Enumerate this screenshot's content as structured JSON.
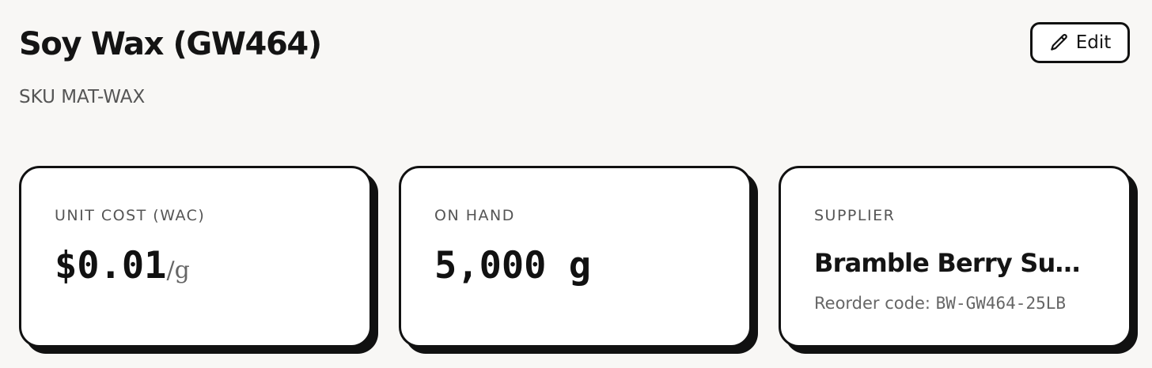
{
  "header": {
    "title": "Soy Wax (GW464)",
    "sku": "SKU MAT-WAX",
    "edit_label": "Edit",
    "edit_icon": "pencil-icon"
  },
  "cards": {
    "unit_cost": {
      "label": "UNIT COST (WAC)",
      "value": "$0.01",
      "unit": "/g"
    },
    "on_hand": {
      "label": "ON HAND",
      "value": "5,000 g"
    },
    "supplier": {
      "label": "SUPPLIER",
      "name": "Bramble Berry Suppl...",
      "reorder_label": "Reorder code:",
      "reorder_code": "BW-GW464-25LB"
    }
  },
  "colors": {
    "background": "#f8f7f5",
    "card_border": "#111111",
    "muted_text": "#555555"
  }
}
